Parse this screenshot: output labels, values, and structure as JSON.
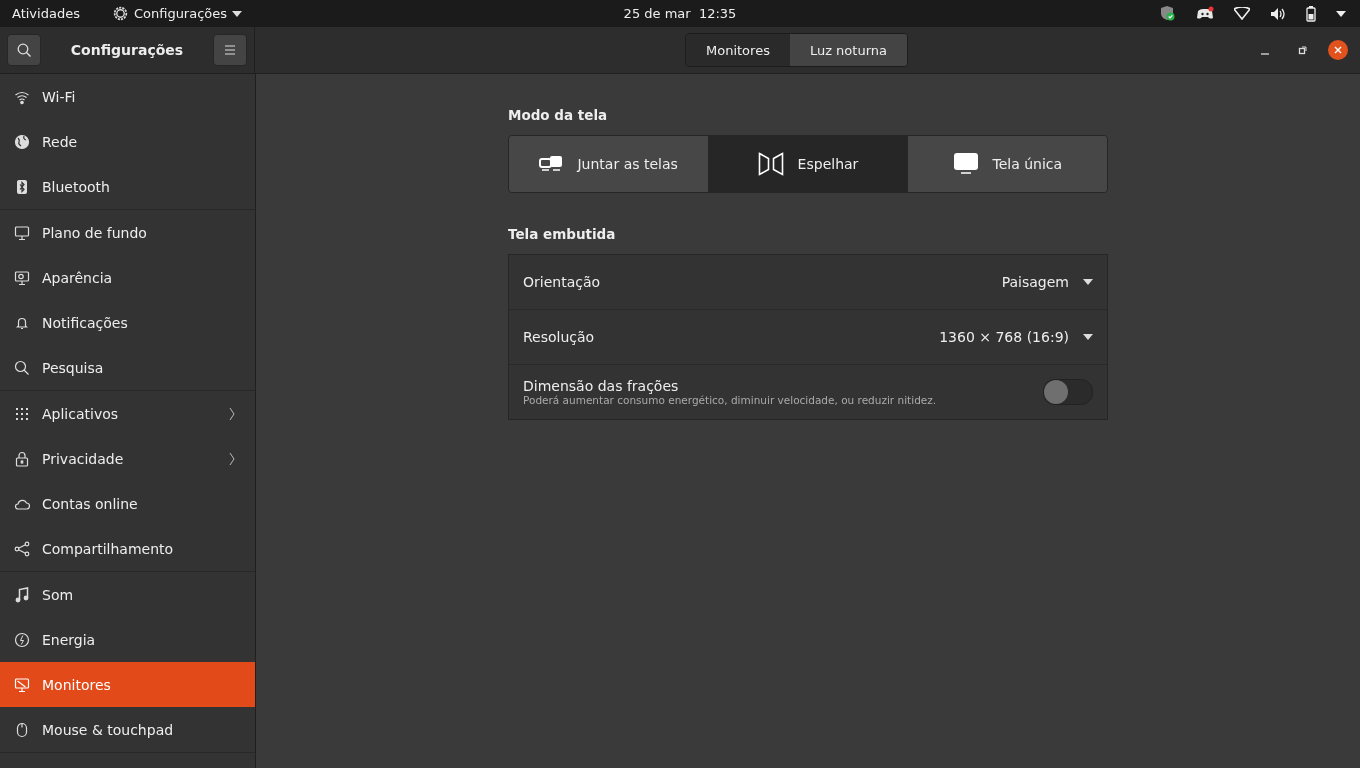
{
  "top_bar": {
    "activities": "Atividades",
    "app_menu": "Configurações",
    "clock": "25 de mar  12:35"
  },
  "header": {
    "title": "Configurações",
    "tabs": [
      {
        "label": "Monitores",
        "selected": true
      },
      {
        "label": "Luz noturna",
        "selected": false
      }
    ]
  },
  "sidebar": {
    "groups": [
      [
        {
          "label": "Wi-Fi",
          "selected": false,
          "submenu": false
        },
        {
          "label": "Rede",
          "selected": false,
          "submenu": false
        },
        {
          "label": "Bluetooth",
          "selected": false,
          "submenu": false
        }
      ],
      [
        {
          "label": "Plano de fundo",
          "selected": false,
          "submenu": false
        },
        {
          "label": "Aparência",
          "selected": false,
          "submenu": false
        },
        {
          "label": "Notificações",
          "selected": false,
          "submenu": false
        },
        {
          "label": "Pesquisa",
          "selected": false,
          "submenu": false
        }
      ],
      [
        {
          "label": "Aplicativos",
          "selected": false,
          "submenu": true
        },
        {
          "label": "Privacidade",
          "selected": false,
          "submenu": true
        },
        {
          "label": "Contas online",
          "selected": false,
          "submenu": false
        },
        {
          "label": "Compartilhamento",
          "selected": false,
          "submenu": false
        }
      ],
      [
        {
          "label": "Som",
          "selected": false,
          "submenu": false
        },
        {
          "label": "Energia",
          "selected": false,
          "submenu": false
        },
        {
          "label": "Monitores",
          "selected": true,
          "submenu": false
        },
        {
          "label": "Mouse & touchpad",
          "selected": false,
          "submenu": false
        }
      ]
    ]
  },
  "display_mode": {
    "heading": "Modo da tela",
    "options": [
      {
        "label": "Juntar as telas",
        "selected": false
      },
      {
        "label": "Espelhar",
        "selected": true
      },
      {
        "label": "Tela única",
        "selected": false
      }
    ]
  },
  "builtin_display": {
    "heading": "Tela embutida",
    "rows": [
      {
        "kind": "dropdown",
        "label": "Orientação",
        "value": "Paisagem"
      },
      {
        "kind": "dropdown",
        "label": "Resolução",
        "value": "1360 × 768 (16:9)"
      },
      {
        "kind": "switch",
        "label": "Dimensão das frações",
        "subtitle": "Poderá aumentar consumo energético, diminuir velocidade, ou reduzir nitidez.",
        "on": false
      }
    ]
  }
}
